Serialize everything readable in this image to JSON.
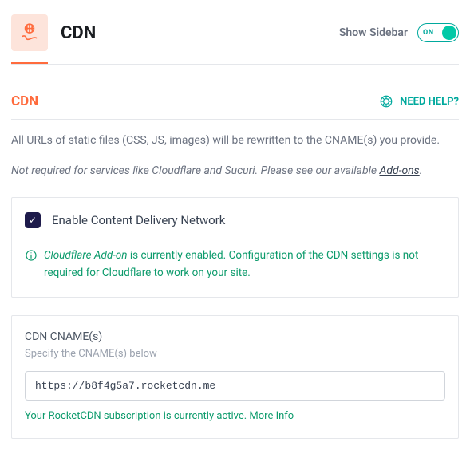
{
  "header": {
    "title": "CDN",
    "showSidebar": "Show Sidebar",
    "toggle": "ON"
  },
  "section": {
    "title": "CDN",
    "help": "NEED HELP?",
    "desc1": "All URLs of static files (CSS, JS, images) will be rewritten to the CNAME(s) you provide.",
    "desc2a": "Not required for services like Cloudflare and Sucuri. Please see our available ",
    "desc2link": "Add-ons",
    "desc2b": "."
  },
  "enable": {
    "label": "Enable Content Delivery Network",
    "checked": true,
    "noticeItalic": "Cloudflare Add-on",
    "noticeRest": " is currently enabled. Configuration of the CDN settings is not required for Cloudflare to work on your site."
  },
  "cname": {
    "title": "CDN CNAME(s)",
    "sub": "Specify the CNAME(s) below",
    "value": "https://b8f4g5a7.rocketcdn.me",
    "activeText": "Your RocketCDN subscription is currently active. ",
    "more": "More Info"
  }
}
